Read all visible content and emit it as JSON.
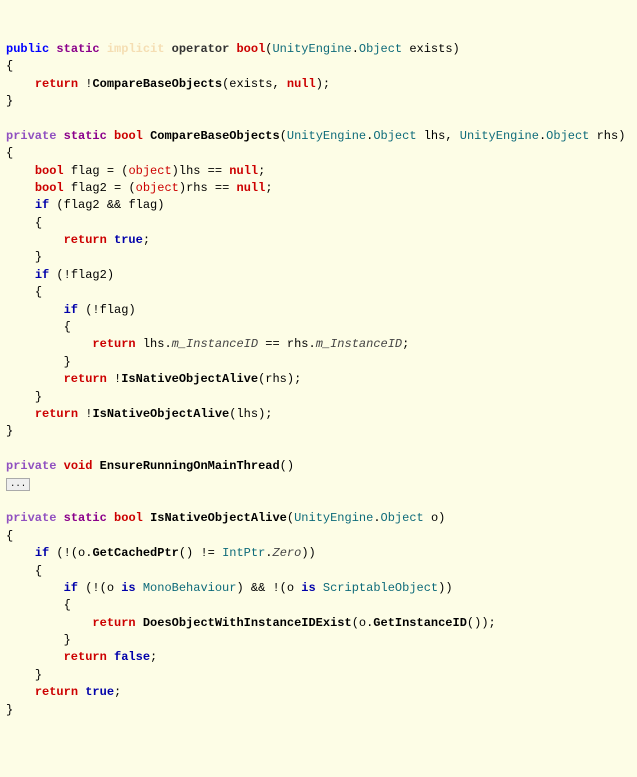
{
  "code": {
    "l1": {
      "public": "public",
      "static": "static",
      "implicit": "implicit",
      "operator": "operator",
      "bool": "bool",
      "lparen": "(",
      "type": "UnityEngine",
      "dot": ".",
      "obj": "Object",
      "sp": " ",
      "param": "exists",
      "rparen": ")"
    },
    "l2": {
      "brace": "{"
    },
    "l3": {
      "indent": "    ",
      "return": "return",
      "sp": " ",
      "bang": "!",
      "fn": "CompareBaseObjects",
      "lparen": "(",
      "arg1": "exists",
      "comma": ", ",
      "null": "null",
      "rparen": ");"
    },
    "l4": {
      "brace": "}"
    },
    "l5": {
      "blank": ""
    },
    "l6": {
      "private": "private",
      "sp": " ",
      "static": "static",
      "sp2": " ",
      "bool": "bool",
      "sp3": " ",
      "fn": "CompareBaseObjects",
      "lparen": "(",
      "type1": "UnityEngine",
      "dot1": ".",
      "obj1": "Object",
      "sp4": " ",
      "p1": "lhs",
      "comma": ", ",
      "type2": "UnityEngine",
      "dot2": ".",
      "obj2": "Object",
      "sp5": " ",
      "p2": "rhs",
      "rparen": ")"
    },
    "l7": {
      "brace": "{"
    },
    "l8": {
      "indent": "    ",
      "bool": "bool",
      "sp": " ",
      "var": "flag",
      "eq": " = (",
      "object": "object",
      "cast": ")",
      "v": "lhs",
      "op": " == ",
      "null": "null",
      "semi": ";"
    },
    "l9": {
      "indent": "    ",
      "bool": "bool",
      "sp": " ",
      "var": "flag2",
      "eq": " = (",
      "object": "object",
      "cast": ")",
      "v": "rhs",
      "op": " == ",
      "null": "null",
      "semi": ";"
    },
    "l10": {
      "indent": "    ",
      "if": "if",
      "sp": " (",
      "v1": "flag2",
      "op": " && ",
      "v2": "flag",
      "rparen": ")"
    },
    "l11": {
      "indent": "    ",
      "brace": "{"
    },
    "l12": {
      "indent": "        ",
      "return": "return",
      "sp": " ",
      "true": "true",
      "semi": ";"
    },
    "l13": {
      "indent": "    ",
      "brace": "}"
    },
    "l14": {
      "indent": "    ",
      "if": "if",
      "sp": " (!",
      "v": "flag2",
      "rparen": ")"
    },
    "l15": {
      "indent": "    ",
      "brace": "{"
    },
    "l16": {
      "indent": "        ",
      "if": "if",
      "sp": " (!",
      "v": "flag",
      "rparen": ")"
    },
    "l17": {
      "indent": "        ",
      "brace": "{"
    },
    "l18": {
      "indent": "            ",
      "return": "return",
      "sp": " ",
      "v1": "lhs",
      "dot1": ".",
      "prop1": "m_InstanceID",
      "op": " == ",
      "v2": "rhs",
      "dot2": ".",
      "prop2": "m_InstanceID",
      "semi": ";"
    },
    "l19": {
      "indent": "        ",
      "brace": "}"
    },
    "l20": {
      "indent": "        ",
      "return": "return",
      "sp": " !",
      "fn": "IsNativeObjectAlive",
      "lparen": "(",
      "arg": "rhs",
      "rparen": ");"
    },
    "l21": {
      "indent": "    ",
      "brace": "}"
    },
    "l22": {
      "indent": "    ",
      "return": "return",
      "sp": " !",
      "fn": "IsNativeObjectAlive",
      "lparen": "(",
      "arg": "lhs",
      "rparen": ");"
    },
    "l23": {
      "brace": "}"
    },
    "l24": {
      "blank": ""
    },
    "l25": {
      "private": "private",
      "sp": " ",
      "void": "void",
      "sp2": " ",
      "fn": "EnsureRunningOnMainThread",
      "parens": "()"
    },
    "l26": {
      "collapsed": "..."
    },
    "l27": {
      "blank": ""
    },
    "l28": {
      "private": "private",
      "sp": " ",
      "static": "static",
      "sp2": " ",
      "bool": "bool",
      "sp3": " ",
      "fn": "IsNativeObjectAlive",
      "lparen": "(",
      "type": "UnityEngine",
      "dot": ".",
      "obj": "Object",
      "sp4": " ",
      "param": "o",
      "rparen": ")"
    },
    "l29": {
      "brace": "{"
    },
    "l30": {
      "indent": "    ",
      "if": "if",
      "sp": " (!(",
      "v": "o",
      "dot": ".",
      "fn": "GetCachedPtr",
      "parens": "()",
      "op": " != ",
      "type": "IntPtr",
      "dot2": ".",
      "prop": "Zero",
      "rparen": "))"
    },
    "l31": {
      "indent": "    ",
      "brace": "{"
    },
    "l32": {
      "indent": "        ",
      "if": "if",
      "sp": " (!(",
      "v1": "o",
      "sp2": " ",
      "is1": "is",
      "sp3": " ",
      "type1": "MonoBehaviour",
      "mid": ") && !(",
      "v2": "o",
      "sp4": " ",
      "is2": "is",
      "sp5": " ",
      "type2": "ScriptableObject",
      "rparen": "))"
    },
    "l33": {
      "indent": "        ",
      "brace": "{"
    },
    "l34": {
      "indent": "            ",
      "return": "return",
      "sp": " ",
      "fn": "DoesObjectWithInstanceIDExist",
      "lparen": "(",
      "v": "o",
      "dot": ".",
      "fn2": "GetInstanceID",
      "parens": "()",
      "rparen": ");"
    },
    "l35": {
      "indent": "        ",
      "brace": "}"
    },
    "l36": {
      "indent": "        ",
      "return": "return",
      "sp": " ",
      "false": "false",
      "semi": ";"
    },
    "l37": {
      "indent": "    ",
      "brace": "}"
    },
    "l38": {
      "indent": "    ",
      "return": "return",
      "sp": " ",
      "true": "true",
      "semi": ";"
    },
    "l39": {
      "brace": "}"
    }
  }
}
